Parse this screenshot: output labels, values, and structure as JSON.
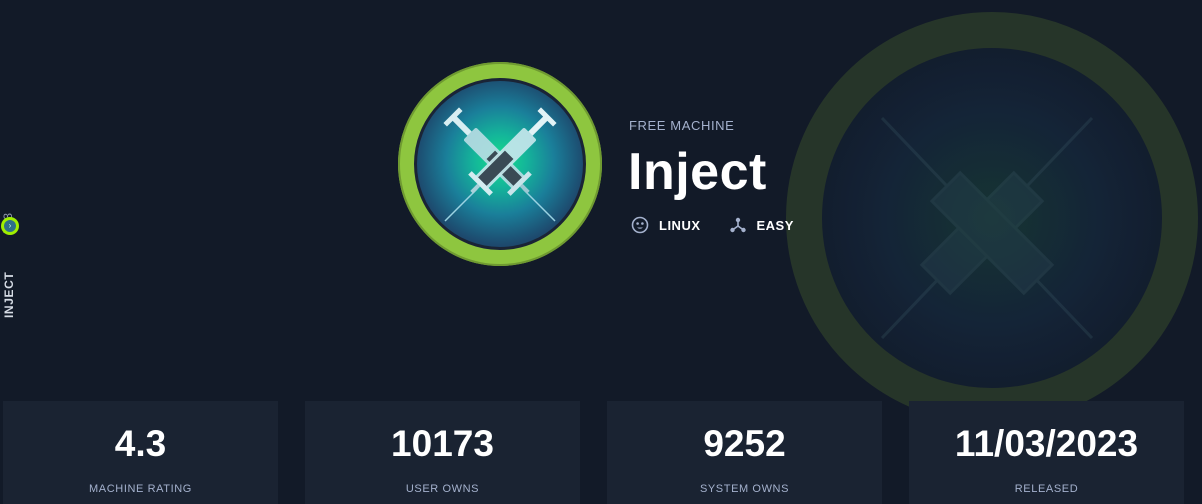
{
  "side": {
    "count": "533",
    "name": "INJECT"
  },
  "machine": {
    "subtitle": "FREE MACHINE",
    "title": "Inject",
    "os": {
      "label": "LINUX",
      "icon": "linux-icon"
    },
    "difficulty": {
      "label": "EASY",
      "icon": "difficulty-icon"
    }
  },
  "stats": [
    {
      "value": "4.3",
      "label": "MACHINE RATING"
    },
    {
      "value": "10173",
      "label": "USER OWNS"
    },
    {
      "value": "9252",
      "label": "SYSTEM OWNS"
    },
    {
      "value": "11/03/2023",
      "label": "RELEASED"
    }
  ],
  "colors": {
    "background": "#121a28",
    "card": "#1a2332",
    "accent_green": "#8ec63f",
    "muted_text": "#a4b1cd"
  }
}
